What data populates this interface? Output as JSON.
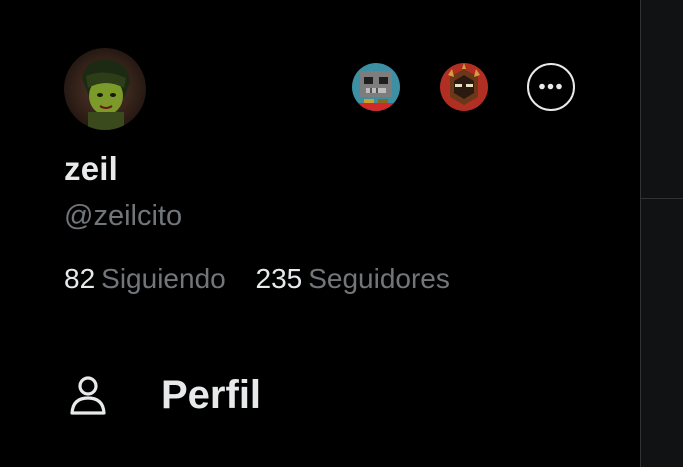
{
  "profile": {
    "display_name": "zeil",
    "handle": "@zeilcito",
    "avatar_icon": "user-avatar"
  },
  "stats": {
    "following_count": "82",
    "following_label": "Siguiendo",
    "followers_count": "235",
    "followers_label": "Seguidores"
  },
  "accounts": [
    {
      "icon": "account-avatar-skull"
    },
    {
      "icon": "account-avatar-helmet"
    }
  ],
  "more_icon": "more-options-icon",
  "menu": {
    "items": [
      {
        "label": "Perfil",
        "icon": "person-icon"
      }
    ]
  },
  "colors": {
    "background": "#000000",
    "text_primary": "#e7e9ea",
    "text_secondary": "#71767b",
    "border": "#2f3336"
  }
}
